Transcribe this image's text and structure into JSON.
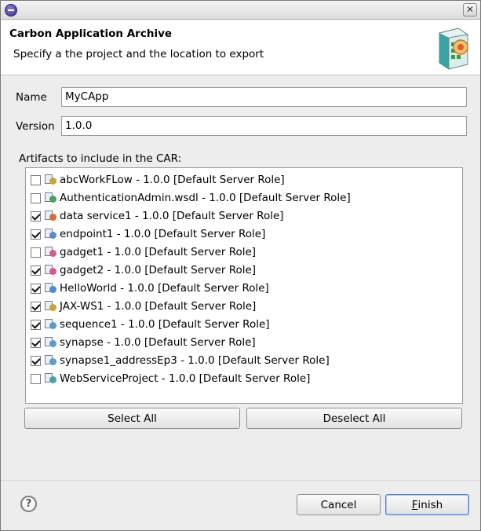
{
  "window": {
    "close_glyph": "✕"
  },
  "banner": {
    "title": "Carbon Application Archive",
    "description": "Specify a the project and the location to export"
  },
  "form": {
    "name_label": "Name",
    "name_value": "MyCApp",
    "version_label": "Version",
    "version_value": "1.0.0",
    "artifacts_label": "Artifacts to include in the CAR:"
  },
  "artifacts": [
    {
      "label": "abcWorkFLow - 1.0.0 [Default Server Role]",
      "checked": false,
      "icon_color": "#c8a33a"
    },
    {
      "label": "AuthenticationAdmin.wsdl - 1.0.0 [Default Server Role]",
      "checked": false,
      "icon_color": "#4aa35a"
    },
    {
      "label": "data service1 - 1.0.0 [Default Server Role]",
      "checked": true,
      "icon_color": "#d86a3a"
    },
    {
      "label": "endpoint1 - 1.0.0 [Default Server Role]",
      "checked": true,
      "icon_color": "#5a8ad0"
    },
    {
      "label": "gadget1 - 1.0.0 [Default Server Role]",
      "checked": false,
      "icon_color": "#d85a8a"
    },
    {
      "label": "gadget2 - 1.0.0 [Default Server Role]",
      "checked": true,
      "icon_color": "#d85a8a"
    },
    {
      "label": "HelloWorld - 1.0.0 [Default Server Role]",
      "checked": true,
      "icon_color": "#4a8ad8"
    },
    {
      "label": "JAX-WS1 - 1.0.0 [Default Server Role]",
      "checked": true,
      "icon_color": "#c8a33a"
    },
    {
      "label": "sequence1 - 1.0.0 [Default Server Role]",
      "checked": true,
      "icon_color": "#5a9ad0"
    },
    {
      "label": "synapse - 1.0.0 [Default Server Role]",
      "checked": true,
      "icon_color": "#5a9ad0"
    },
    {
      "label": "synapse1_addressEp3 - 1.0.0 [Default Server Role]",
      "checked": true,
      "icon_color": "#5a9ad0"
    },
    {
      "label": "WebServiceProject - 1.0.0 [Default Server Role]",
      "checked": false,
      "icon_color": "#4aa3a3"
    }
  ],
  "buttons": {
    "select_all": "Select All",
    "deselect_all": "Deselect All",
    "cancel": "Cancel",
    "finish_mnemonic": "F",
    "finish_rest": "inish"
  },
  "help": {
    "glyph": "?"
  }
}
